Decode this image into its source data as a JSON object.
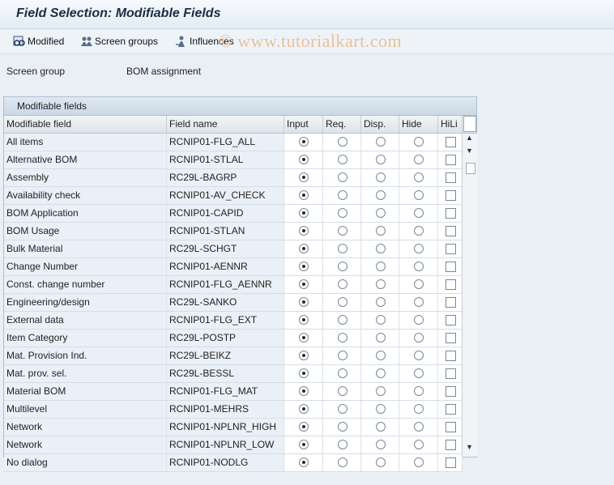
{
  "window": {
    "title": "Field Selection: Modifiable Fields"
  },
  "toolbar": {
    "buttons": [
      {
        "label": "Modified",
        "icon": "glasses-icon"
      },
      {
        "label": "Screen groups",
        "icon": "group-icon"
      },
      {
        "label": "Influences",
        "icon": "influence-icon"
      }
    ]
  },
  "watermark": "© www.tutorialkart.com",
  "screen_group": {
    "label": "Screen group",
    "value": "BOM assignment"
  },
  "panel": {
    "title": "Modifiable fields"
  },
  "table": {
    "columns": [
      "Modifiable field",
      "Field name",
      "Input",
      "Req.",
      "Disp.",
      "Hide",
      "HiLi"
    ],
    "rows": [
      {
        "field": "All items",
        "name": "RCNIP01-FLG_ALL",
        "selected": "Input",
        "hili": false
      },
      {
        "field": "Alternative BOM",
        "name": "RCNIP01-STLAL",
        "selected": "Input",
        "hili": false
      },
      {
        "field": "Assembly",
        "name": "RC29L-BAGRP",
        "selected": "Input",
        "hili": false
      },
      {
        "field": "Availability check",
        "name": "RCNIP01-AV_CHECK",
        "selected": "Input",
        "hili": false
      },
      {
        "field": "BOM Application",
        "name": "RCNIP01-CAPID",
        "selected": "Input",
        "hili": false
      },
      {
        "field": "BOM Usage",
        "name": "RCNIP01-STLAN",
        "selected": "Input",
        "hili": false
      },
      {
        "field": "Bulk Material",
        "name": "RC29L-SCHGT",
        "selected": "Input",
        "hili": false
      },
      {
        "field": "Change Number",
        "name": "RCNIP01-AENNR",
        "selected": "Input",
        "hili": false
      },
      {
        "field": "Const. change number",
        "name": "RCNIP01-FLG_AENNR",
        "selected": "Input",
        "hili": false
      },
      {
        "field": "Engineering/design",
        "name": "RC29L-SANKO",
        "selected": "Input",
        "hili": false
      },
      {
        "field": "External data",
        "name": "RCNIP01-FLG_EXT",
        "selected": "Input",
        "hili": false
      },
      {
        "field": "Item Category",
        "name": "RC29L-POSTP",
        "selected": "Input",
        "hili": false
      },
      {
        "field": "Mat. Provision Ind.",
        "name": "RC29L-BEIKZ",
        "selected": "Input",
        "hili": false
      },
      {
        "field": "Mat. prov. sel.",
        "name": "RC29L-BESSL",
        "selected": "Input",
        "hili": false
      },
      {
        "field": "Material BOM",
        "name": "RCNIP01-FLG_MAT",
        "selected": "Input",
        "hili": false
      },
      {
        "field": "Multilevel",
        "name": "RCNIP01-MEHRS",
        "selected": "Input",
        "hili": false
      },
      {
        "field": "Network",
        "name": "RCNIP01-NPLNR_HIGH",
        "selected": "Input",
        "hili": false
      },
      {
        "field": "Network",
        "name": "RCNIP01-NPLNR_LOW",
        "selected": "Input",
        "hili": false
      },
      {
        "field": "No dialog",
        "name": "RCNIP01-NODLG",
        "selected": "Input",
        "hili": false
      }
    ]
  }
}
